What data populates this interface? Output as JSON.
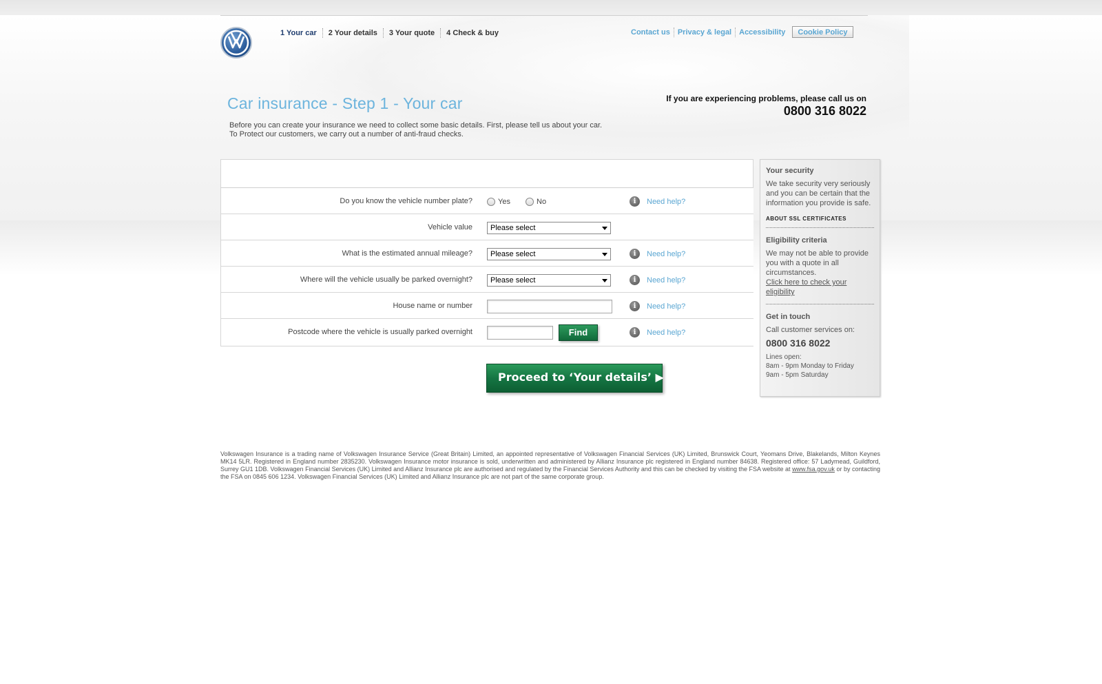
{
  "header": {
    "steps": [
      "1 Your car",
      "2 Your details",
      "3 Your quote",
      "4 Check & buy"
    ],
    "links": [
      "Contact us",
      "Privacy & legal",
      "Accessibility"
    ],
    "cookie_button": "Cookie Policy"
  },
  "title": "Car insurance - Step 1 - Your car",
  "intro": {
    "line1": "Before you can create your insurance we need to collect some basic details. First, please tell us about your car.",
    "line2": "To Protect our customers, we carry out a number of anti-fraud checks."
  },
  "problems": {
    "text": "If you are experiencing problems, please call us on",
    "phone": "0800 316 8022"
  },
  "form": {
    "plate": {
      "label": "Do you know the vehicle number plate?",
      "yes": "Yes",
      "no": "No",
      "help": "Need help?",
      "info": "i"
    },
    "value": {
      "label": "Vehicle value",
      "selected": "Please select"
    },
    "mileage": {
      "label": "What is the estimated annual mileage?",
      "selected": "Please select",
      "help": "Need help?",
      "info": "i"
    },
    "parked": {
      "label": "Where will the vehicle usually be parked overnight?",
      "selected": "Please select",
      "help": "Need help?",
      "info": "i"
    },
    "house": {
      "label": "House name or number",
      "value": "",
      "help": "Need help?",
      "info": "i"
    },
    "postcode": {
      "label": "Postcode where the vehicle is usually parked overnight",
      "value": "",
      "find": "Find",
      "help": "Need help?",
      "info": "i"
    },
    "proceed": "Proceed to ‘Your details’ ▶"
  },
  "sidebar": {
    "security_title": "Your security",
    "security_text": "We take security very seriously and you can be certain that the information you provide is safe.",
    "ssl": "ABOUT SSL CERTIFICATES",
    "eligibility_title": "Eligibility criteria",
    "eligibility_text": "We may not be able to provide you with a quote in all circumstances.",
    "eligibility_link": "Click here to check your eligibility",
    "contact_title": "Get in touch",
    "contact_text": "Call customer services on:",
    "contact_phone": "0800 316 8022",
    "lines_open": "Lines open:",
    "hours1": "8am - 9pm Monday to Friday",
    "hours2": "9am - 5pm Saturday"
  },
  "footer": {
    "text_before": "Volkswagen Insurance is a trading name of Volkswagen Insurance Service (Great Britain) Limited, an appointed representative of Volkswagen Financial Services (UK) Limited, Brunswick Court, Yeomans Drive, Blakelands, Milton Keynes MK14 5LR. Registered in England number 2835230. Volkswagen Insurance motor insurance is sold, underwritten and administered by Allianz Insurance plc registered in England number 84638. Registered office: 57 Ladymead, Guildford, Surrey GU1 1DB. Volkswagen Financial Services (UK) Limited and Allianz Insurance plc are authorised and regulated by the Financial Services Authority and this can be checked by visiting the FSA website at",
    "link": "www.fsa.gov.uk",
    "text_after": "or by contacting the FSA on 0845 606 1234. Volkswagen Financial Services (UK) Limited and Allianz Insurance plc are not part of the same corporate group."
  },
  "colors": {
    "accent_blue": "#5aa6d2",
    "title_blue": "#6cb4dd",
    "button_green": "#157543"
  },
  "icons": {
    "logo": "vw-logo",
    "info": "info-icon",
    "dropdown": "chevron-down-icon",
    "arrow": "play-arrow-icon"
  }
}
